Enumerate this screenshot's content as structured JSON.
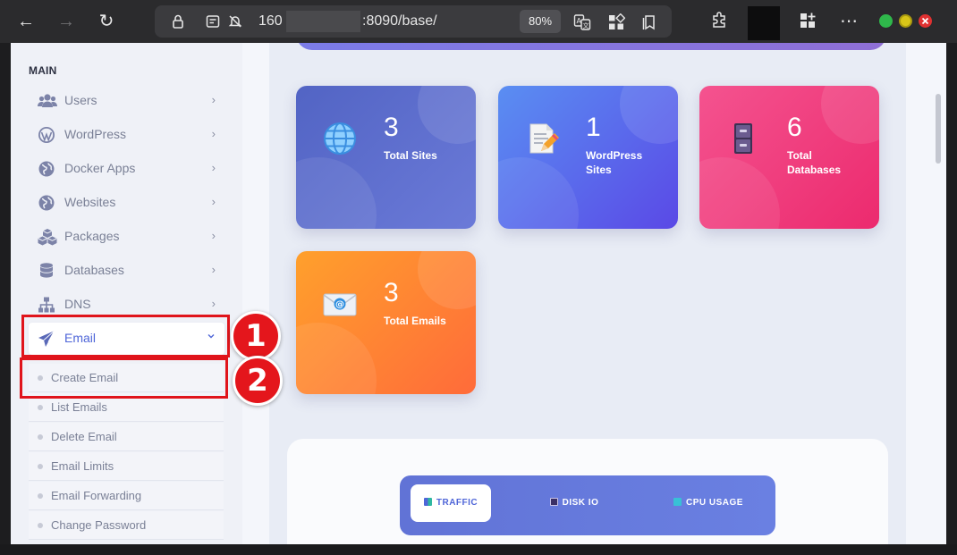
{
  "browser": {
    "url_prefix": "160",
    "url_suffix": ":8090/base/",
    "zoom": "80%"
  },
  "sidebar": {
    "section_label": "MAIN",
    "items": [
      {
        "label": "Users",
        "icon": "users-icon"
      },
      {
        "label": "WordPress",
        "icon": "wordpress-icon"
      },
      {
        "label": "Docker Apps",
        "icon": "globe-icon"
      },
      {
        "label": "Websites",
        "icon": "globe-icon"
      },
      {
        "label": "Packages",
        "icon": "cubes-icon"
      },
      {
        "label": "Databases",
        "icon": "database-icon"
      },
      {
        "label": "DNS",
        "icon": "sitemap-icon"
      },
      {
        "label": "Email",
        "icon": "paper-plane-icon",
        "active": true
      }
    ],
    "email_submenu": [
      {
        "label": "Create Email"
      },
      {
        "label": "List Emails"
      },
      {
        "label": "Delete Email"
      },
      {
        "label": "Email Limits"
      },
      {
        "label": "Email Forwarding"
      },
      {
        "label": "Change Password"
      }
    ]
  },
  "stats": [
    {
      "value": "3",
      "label": "Total Sites",
      "icon": "globe-icon",
      "colors": [
        "#5264c4",
        "#6b7ad8"
      ]
    },
    {
      "value": "1",
      "label": "WordPress Sites",
      "icon": "document-pen-icon",
      "colors": [
        "#5a8ef2",
        "#5a49e6"
      ]
    },
    {
      "value": "6",
      "label": "Total Databases",
      "icon": "file-cabinet-icon",
      "colors": [
        "#f4538f",
        "#ec2a6e"
      ]
    },
    {
      "value": "3",
      "label": "Total Emails",
      "icon": "envelope-icon",
      "colors": [
        "#ffa02c",
        "#ff6b3a"
      ]
    }
  ],
  "graph_tabs": [
    {
      "label": "TRAFFIC",
      "active": true
    },
    {
      "label": "DISK IO"
    },
    {
      "label": "CPU USAGE"
    }
  ],
  "annotations": [
    {
      "number": "1"
    },
    {
      "number": "2"
    }
  ],
  "colors": {
    "highlight": "#e0141b",
    "accent": "#4f66d8"
  }
}
